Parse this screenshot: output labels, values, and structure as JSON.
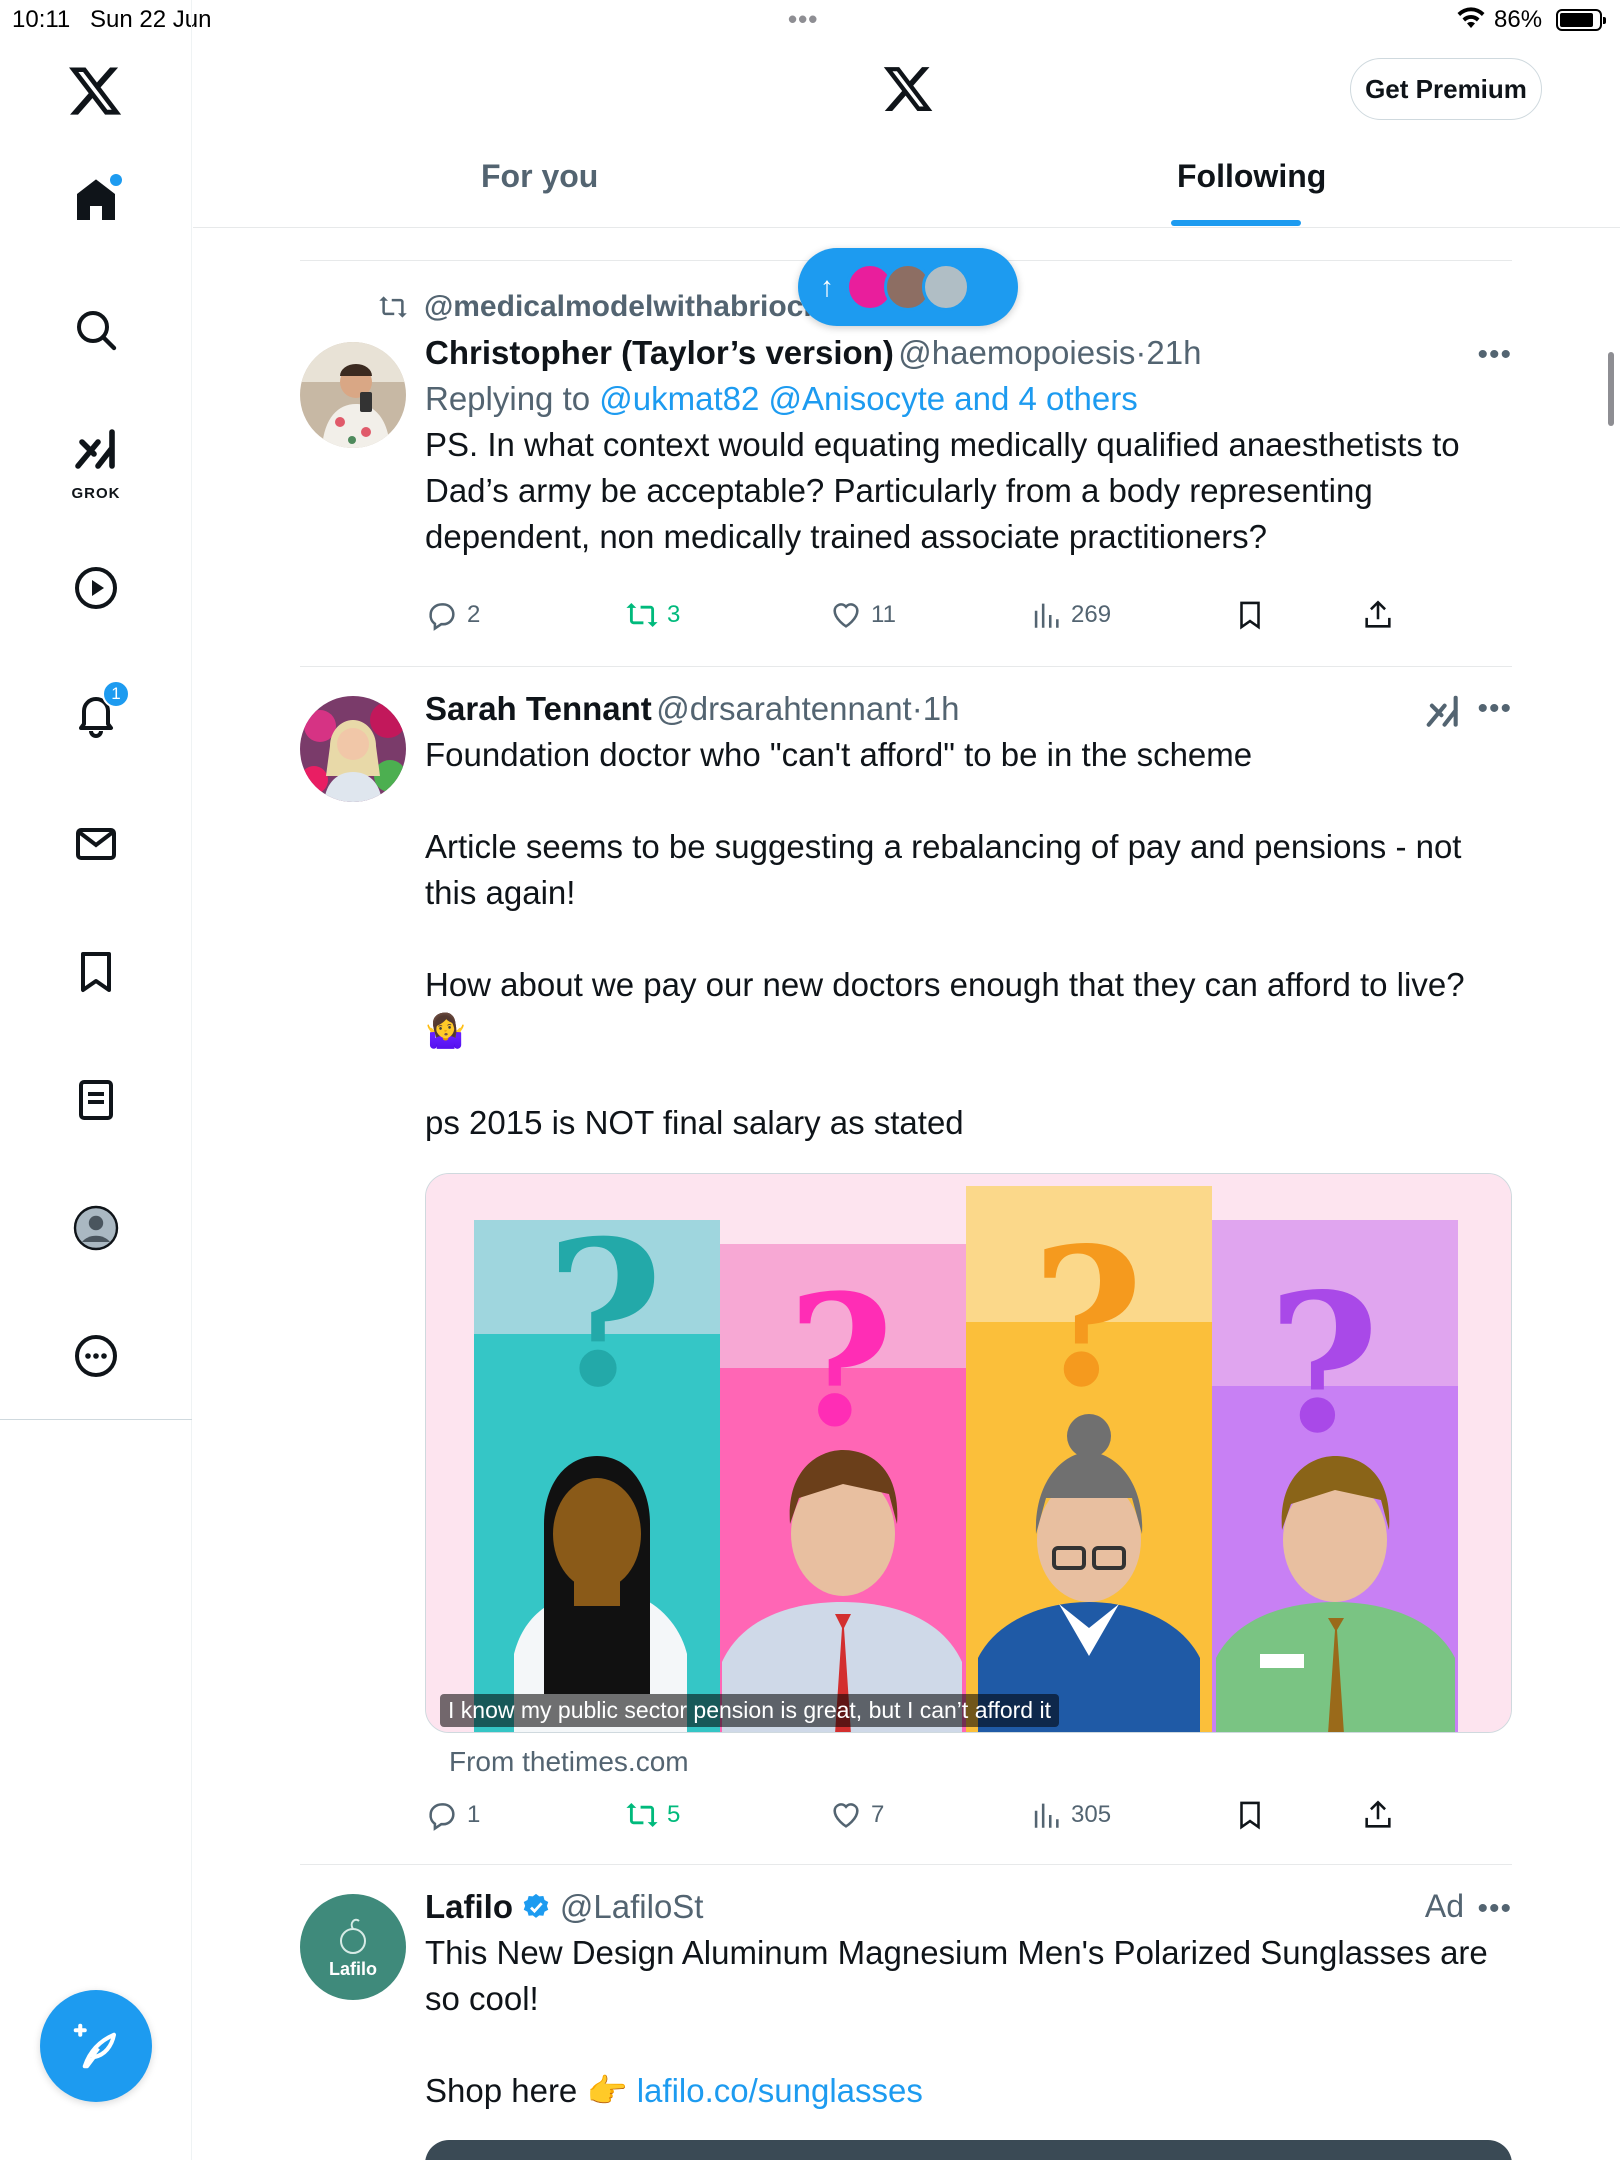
{
  "status_bar": {
    "time": "10:11",
    "date": "Sun 22 Jun",
    "battery_pct": "86%",
    "battery_level": 0.86
  },
  "header": {
    "get_premium": "Get Premium",
    "tabs": [
      {
        "label": "For you",
        "selected": false
      },
      {
        "label": "Following",
        "selected": true
      }
    ]
  },
  "nav": {
    "items": [
      "x-logo",
      "home",
      "search",
      "grok",
      "video",
      "notifications",
      "messages",
      "bookmarks",
      "lists",
      "profile",
      "more"
    ],
    "grok_label": "GROK",
    "notifications_badge": "1"
  },
  "new_posts_pill": {
    "arrow": "↑"
  },
  "posts": [
    {
      "repost_by": "@medicalmodelwithabrioch",
      "repost_suffix": "reposted",
      "name": "Christopher (Taylor’s version)",
      "handle": "@haemopoiesis",
      "time": "21h",
      "replying_prefix": "Replying to",
      "replying_to": "@ukmat82 @Anisocyte and 4 others",
      "text": "PS. In what context would equating medically qualified anaesthetists to Dad’s army be acceptable? Particularly from a body representing dependent, non medically trained associate practitioners?",
      "replies": "2",
      "reposts": "3",
      "likes": "11",
      "views": "269"
    },
    {
      "name": "Sarah Tennant",
      "handle": "@drsarahtennant",
      "time": "1h",
      "text_lines": [
        "Foundation doctor who \"can't afford\" to be in the scheme",
        "Article seems to be suggesting a rebalancing of pay and pensions - not this again!",
        "How about we pay our new doctors enough that they can afford to live? 🤷‍♀️",
        "ps 2015 is NOT final salary as stated"
      ],
      "card_caption": "I know my public sector pension is great, but I can’t afford it",
      "card_source": "From thetimes.com",
      "replies": "1",
      "reposts": "5",
      "likes": "7",
      "views": "305"
    },
    {
      "name": "Lafilo",
      "handle": "@LafiloSt",
      "ad_label": "Ad",
      "avatar_text": "Lafilo",
      "text": "This New Design Aluminum Magnesium Men's Polarized Sunglasses are so cool!",
      "shop_prefix": "Shop here 👉",
      "shop_link": "lafilo.co/sunglasses"
    }
  ],
  "colors": {
    "accent": "#1d9bf0",
    "repost_green": "#00ba7c",
    "secondary_text": "#536471"
  }
}
